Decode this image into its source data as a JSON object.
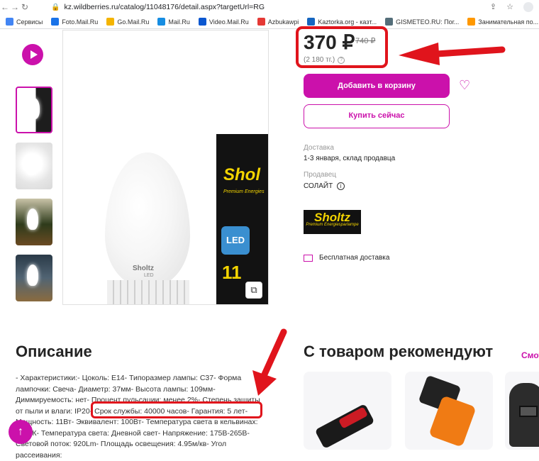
{
  "browser": {
    "url": "kz.wildberries.ru/catalog/11048176/detail.aspx?targetUrl=RG",
    "bookmarks": [
      {
        "label": "Сервисы",
        "color": "#4285f4"
      },
      {
        "label": "Foto.Mail.Ru",
        "color": "#1a73e8"
      },
      {
        "label": "Go.Mail.Ru",
        "color": "#f4b400"
      },
      {
        "label": "Mail.Ru",
        "color": "#168de2"
      },
      {
        "label": "Video.Mail.Ru",
        "color": "#0b57d0"
      },
      {
        "label": "Azbukawpi",
        "color": "#e53935"
      },
      {
        "label": "Kaztorka.org - казт...",
        "color": "#1565c0"
      },
      {
        "label": "GISMETEO.RU: Пог...",
        "color": "#546e7a"
      },
      {
        "label": "Занимательная по...",
        "color": "#ff9800"
      }
    ]
  },
  "product": {
    "price": "370 ₽",
    "old_price": "740 ₽",
    "price_kzt": "(2 180 тг.)",
    "add_to_cart": "Добавить в корзину",
    "buy_now": "Купить сейчас",
    "delivery_label": "Доставка",
    "delivery_value": "1-3 января, склад продавца",
    "seller_label": "Продавец",
    "seller_value": "СОЛАЙТ",
    "brand_logo": "Sholtz",
    "brand_tagline": "Premium Energiesparlampe",
    "free_shipping": "Бесплатная доставка"
  },
  "image": {
    "bulb_brand": "Sholtz",
    "bulb_sub": "LED",
    "box_brand": "Shol",
    "box_tagline": "Premium Energies",
    "box_led": "LED",
    "box_watt": "11"
  },
  "description": {
    "title": "Описание",
    "text": "- Характеристики:- Цоколь: E14- Типоразмер лампы: C37- Форма лампочки: Свеча- Диаметр: 37мм- Высота лампы: 109мм- Диммируемость: нет- Процент пульсации: менее 2%- Степень защиты от пыли и влаги: IP20- Срок службы: 40000 часов- Гарантия: 5 лет- Мощность: 11Вт- Эквивалент: 100Вт- Температура света в кельвинах: 4200К- Температура света: Дневной свет- Напряжение: 175В-265В- Световой поток: 920Lm- Площадь освещения: 4.95м/кв- Угол рассеивания:"
  },
  "recommend": {
    "title": "С товаром рекомендуют",
    "link": "Смот"
  },
  "colors": {
    "accent": "#cb11ab",
    "annotation_red": "#e0141c"
  }
}
